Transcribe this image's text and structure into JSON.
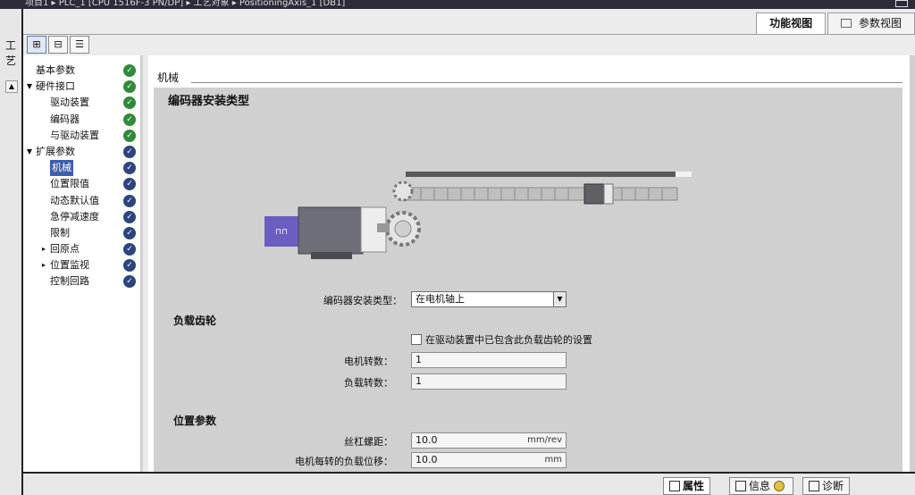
{
  "window": {
    "title_fragment": "项目1 ▸ PLC_1 [CPU 1516F-3 PN/DP] ▸ 工艺对象 ▸ PositioningAxis_1 [DB1]"
  },
  "right_tabs": [
    {
      "label": "功能视图",
      "active": true
    },
    {
      "label": "参数视图",
      "active": false
    }
  ],
  "toolbar": {
    "btn1": "⊞",
    "btn2": "⊟",
    "btn3": "☰"
  },
  "left_frame": {
    "label": "工艺"
  },
  "tree": [
    {
      "label": "基本参数",
      "indent": 0,
      "arrow": "",
      "status": "green",
      "selected": false
    },
    {
      "label": "硬件接口",
      "indent": 0,
      "arrow": "▼",
      "status": "green",
      "selected": false
    },
    {
      "label": "驱动装置",
      "indent": 1,
      "arrow": "",
      "status": "green",
      "selected": false
    },
    {
      "label": "编码器",
      "indent": 1,
      "arrow": "",
      "status": "green",
      "selected": false
    },
    {
      "label": "与驱动装置",
      "indent": 1,
      "arrow": "",
      "status": "green",
      "selected": false
    },
    {
      "label": "扩展参数",
      "indent": 0,
      "arrow": "▼",
      "status": "blue",
      "selected": false
    },
    {
      "label": "机械",
      "indent": 1,
      "arrow": "",
      "status": "blue",
      "selected": true
    },
    {
      "label": "位置限值",
      "indent": 1,
      "arrow": "",
      "status": "blue",
      "selected": false
    },
    {
      "label": "动态默认值",
      "indent": 1,
      "arrow": "",
      "status": "blue",
      "selected": false
    },
    {
      "label": "急停减速度",
      "indent": 1,
      "arrow": "",
      "status": "blue",
      "selected": false
    },
    {
      "label": "限制",
      "indent": 1,
      "arrow": "",
      "status": "blue",
      "selected": false
    },
    {
      "label": "回原点",
      "indent": 1,
      "arrow": "▸",
      "status": "blue",
      "selected": false
    },
    {
      "label": "位置监视",
      "indent": 1,
      "arrow": "▸",
      "status": "blue",
      "selected": false
    },
    {
      "label": "控制回路",
      "indent": 1,
      "arrow": "",
      "status": "blue",
      "selected": false
    }
  ],
  "content": {
    "section_head": "机械",
    "form_title": "编码器安装类型",
    "encoder_label": "编码器安装类型：",
    "encoder_value": "在电机轴上",
    "load_section": "负载齿轮",
    "cb_label": "在驱动装置中已包含此负载齿轮的设置",
    "motor_rev_label": "电机转数：",
    "motor_rev_value": "1",
    "load_rev_label": "负载转数：",
    "load_rev_value": "1",
    "pos_section": "位置参数",
    "lead_label": "丝杠螺距：",
    "lead_value": "10.0",
    "lead_unit": "mm/rev",
    "per_rev_label": "电机每转的负载位移：",
    "per_rev_value": "10.0",
    "per_rev_unit": "mm"
  },
  "bottom": {
    "properties": "属性",
    "info": "信息",
    "diagnostics": "诊断"
  },
  "colors": {
    "selection": "#3b5ea8",
    "status_green": "#2e8b3a",
    "status_blue": "#2c4580",
    "form_bg": "#d0d0d0",
    "motor_purple": "#6a5fc0"
  },
  "icons": [
    "gear-icon",
    "motor-icon",
    "checkmark-icon",
    "dropdown-arrow-icon",
    "properties-icon",
    "info-icon",
    "diagnostics-icon"
  ]
}
